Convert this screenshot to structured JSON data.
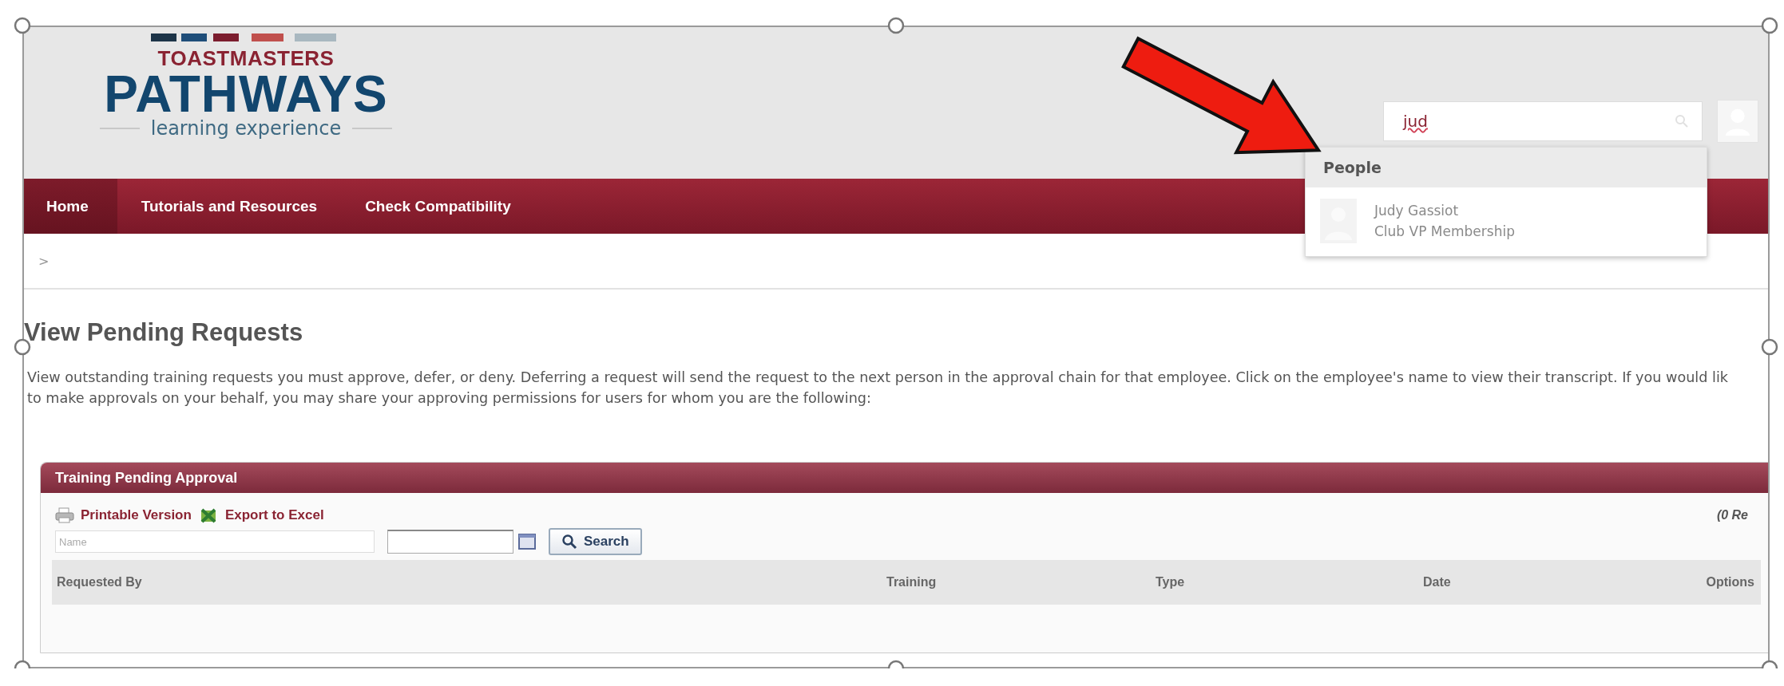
{
  "logo": {
    "brand": "TOASTMASTERS",
    "title": "PATHWAYS",
    "tagline": "learning experience"
  },
  "search": {
    "value": "jud"
  },
  "search_dropdown": {
    "heading": "People",
    "results": [
      {
        "name": "Judy Gassiot",
        "role": "Club VP Membership"
      }
    ]
  },
  "nav": {
    "items": [
      {
        "label": "Home",
        "selected": true
      },
      {
        "label": "Tutorials and Resources",
        "selected": false
      },
      {
        "label": "Check Compatibility",
        "selected": false
      }
    ]
  },
  "breadcrumb": ">",
  "page": {
    "title": "View Pending Requests",
    "description_lines": [
      "View outstanding training requests you must approve, defer, or deny. Deferring a request will send the request to the next person in the approval chain for that employee. Click on the employee's name to view their transcript. If you would lik",
      "to make approvals on your behalf, you may share your approving permissions for users for whom you are the following:"
    ]
  },
  "panel": {
    "title": "Training Pending Approval",
    "actions": [
      {
        "kind": "print",
        "label": "Printable Version"
      },
      {
        "kind": "excel",
        "label": "Export to Excel"
      }
    ],
    "record_count": "(0 Re",
    "name_filter": {
      "placeholder": "Name"
    },
    "search_button": "Search",
    "columns": [
      "Requested By",
      "Training",
      "Type",
      "Date",
      "Options"
    ]
  }
}
